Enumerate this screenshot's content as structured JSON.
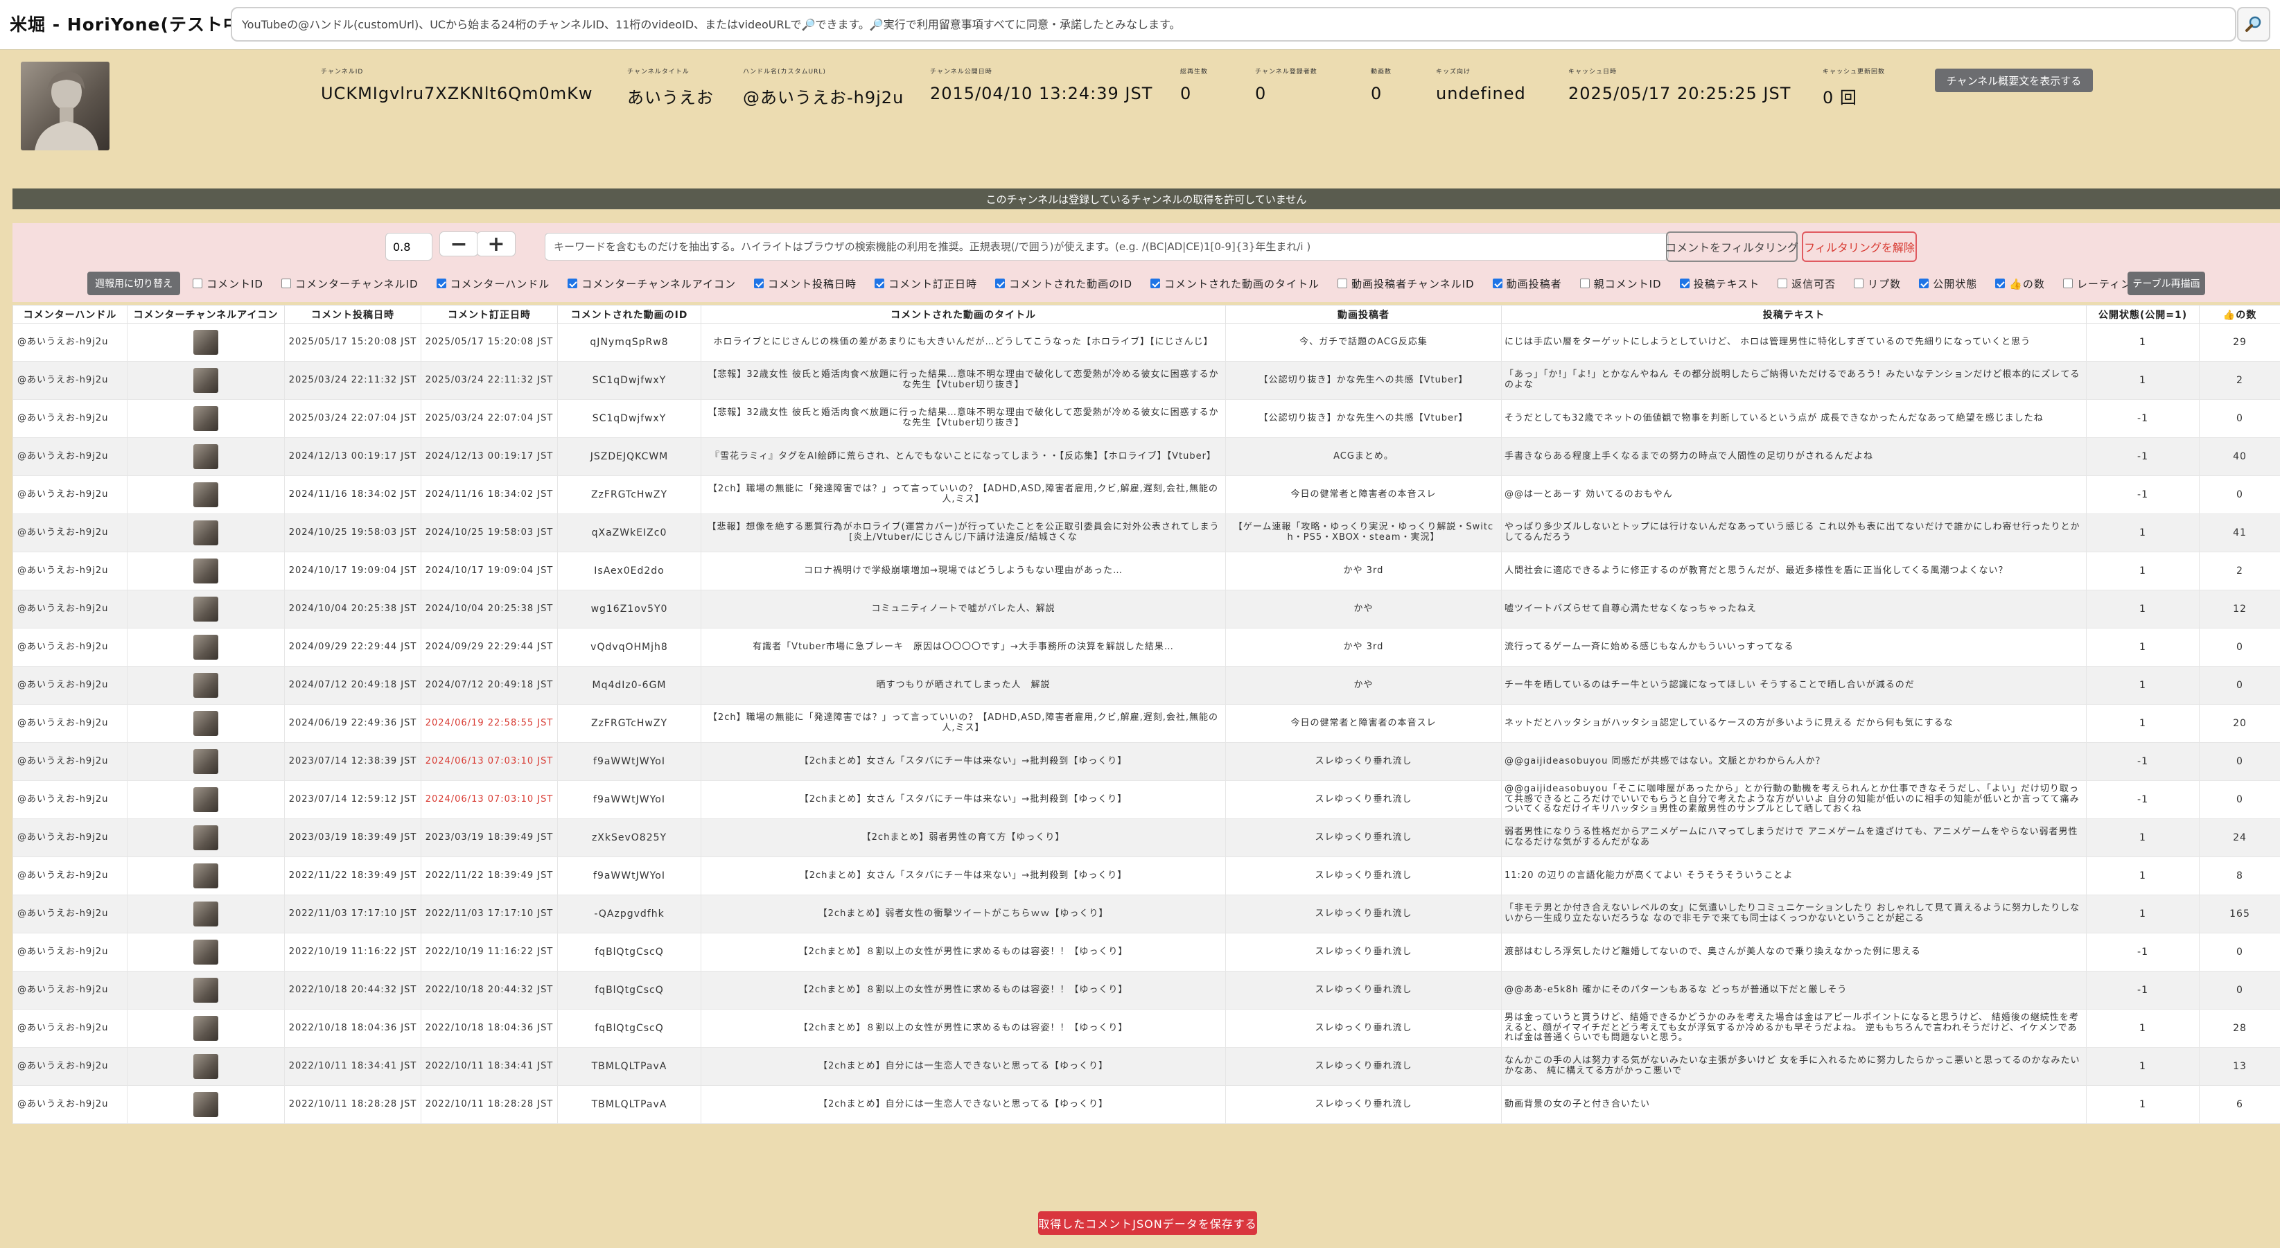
{
  "app": {
    "title": "米堀 - HoriYone(テスト中)"
  },
  "search": {
    "placeholder": "YouTubeの@ハンドル(customUrl)、UCから始まる24桁のチャンネルID、11桁のvideoID、またはvideoURLで🔎できます。🔎実行で利用留意事項すべてに同意・承諾したとみなします。",
    "button_icon": "magnifier-icon"
  },
  "channel": {
    "fields": [
      {
        "label": "チャンネルID",
        "value": "UCKMIgvlru7XZKNlt6Qm0mKw"
      },
      {
        "label": "チャンネルタイトル",
        "value": "あいうえお"
      },
      {
        "label": "ハンドル名(カスタムURL)",
        "value": "@あいうえお-h9j2u"
      },
      {
        "label": "チャンネル公開日時",
        "value": "2015/04/10 13:24:39 JST"
      },
      {
        "label": "総再生数",
        "value": "0"
      },
      {
        "label": "チャンネル登録者数",
        "value": "0"
      },
      {
        "label": "動画数",
        "value": "0"
      },
      {
        "label": "キッズ向け",
        "value": "undefined"
      },
      {
        "label": "キャッシュ日時",
        "value": "2025/05/17 20:25:25 JST"
      },
      {
        "label": "キャッシュ更新回数",
        "value": "0 回"
      }
    ],
    "show_description_label": "チャンネル概要文を表示する"
  },
  "notice": "このチャンネルは登録しているチャンネルの取得を許可していません",
  "filter": {
    "threshold_value": "0.8",
    "minus_label": "−",
    "plus_label": "+",
    "keyword_placeholder": "キーワードを含むものだけを抽出する。ハイライトはブラウザの検索機能の利用を推奨。正規表現(/で囲う)が使えます。(e.g. /(BC|AD|CE)1[0-9]{3}年生まれ/i )",
    "filter_button": "コメントをフィルタリング",
    "clear_button": "フィルタリングを解除",
    "compact_button": "週報用に切り替え",
    "redraw_button": "テーブル再描画",
    "toggles": [
      {
        "label": "コメントID",
        "checked": false
      },
      {
        "label": "コメンターチャンネルID",
        "checked": false
      },
      {
        "label": "コメンターハンドル",
        "checked": true
      },
      {
        "label": "コメンターチャンネルアイコン",
        "checked": true
      },
      {
        "label": "コメント投稿日時",
        "checked": true
      },
      {
        "label": "コメント訂正日時",
        "checked": true
      },
      {
        "label": "コメントされた動画のID",
        "checked": true
      },
      {
        "label": "コメントされた動画のタイトル",
        "checked": true
      },
      {
        "label": "動画投稿者チャンネルID",
        "checked": false
      },
      {
        "label": "動画投稿者",
        "checked": true
      },
      {
        "label": "親コメントID",
        "checked": false
      },
      {
        "label": "投稿テキスト",
        "checked": true
      },
      {
        "label": "返信可否",
        "checked": false
      },
      {
        "label": "リプ数",
        "checked": false
      },
      {
        "label": "公開状態",
        "checked": true
      },
      {
        "label": "👍の数",
        "checked": true
      },
      {
        "label": "レーティング",
        "checked": false
      }
    ]
  },
  "table": {
    "columns": [
      "コメンターハンドル",
      "コメンターチャンネルアイコン",
      "コメント投稿日時",
      "コメント訂正日時",
      "コメントされた動画のID",
      "コメントされた動画のタイトル",
      "動画投稿者",
      "投稿テキスト",
      "公開状態(公開=1)",
      "👍の数"
    ],
    "rows": [
      {
        "handle": "@あいうえお-h9j2u",
        "posted": "2025/05/17 15:20:08 JST",
        "edited": "2025/05/17 15:20:08 JST",
        "edited_red": false,
        "video_id": "qJNymqSpRw8",
        "title": "ホロライブとにじさんじの株価の差があまりにも大きいんだが…どうしてこうなった【ホロライブ】【にじさんじ】",
        "author": "今、ガチで話題のACG反応集",
        "text": "にじは手広い層をターゲットにしようとしていけど、 ホロは管理男性に特化しすぎているので先細りになっていくと思う",
        "public": "1",
        "likes": "29"
      },
      {
        "handle": "@あいうえお-h9j2u",
        "posted": "2025/03/24 22:11:32 JST",
        "edited": "2025/03/24 22:11:32 JST",
        "edited_red": false,
        "video_id": "SC1qDwjfwxY",
        "title": "【悲報】32歳女性 彼氏と婚活肉食べ放題に行った結果…意味不明な理由で破化して恋愛熱が冷める彼女に困惑するかな先生【Vtuber切り抜き】",
        "author": "【公認切り抜き】かな先生への共感【Vtuber】",
        "text": "「あっ」「か!」「よ!」とかなんやねん その都分説明したらご納得いただけるであろう！みたいなテンションだけど根本的にズレてるのよな",
        "public": "1",
        "likes": "2"
      },
      {
        "handle": "@あいうえお-h9j2u",
        "posted": "2025/03/24 22:07:04 JST",
        "edited": "2025/03/24 22:07:04 JST",
        "edited_red": false,
        "video_id": "SC1qDwjfwxY",
        "title": "【悲報】32歳女性 彼氏と婚活肉食べ放題に行った結果…意味不明な理由で破化して恋愛熱が冷める彼女に困惑するかな先生【Vtuber切り抜き】",
        "author": "【公認切り抜き】かな先生への共感【Vtuber】",
        "text": "そうだとしても32歳でネットの価値観で物事を判断しているという点が 成長できなかったんだなあって絶望を感じましたね",
        "public": "-1",
        "likes": "0"
      },
      {
        "handle": "@あいうえお-h9j2u",
        "posted": "2024/12/13 00:19:17 JST",
        "edited": "2024/12/13 00:19:17 JST",
        "edited_red": false,
        "video_id": "JSZDEJQKCWM",
        "title": "『雪花ラミィ』タグをAI絵師に荒らされ、とんでもないことになってしまう・・【反応集】【ホロライブ】【Vtuber】",
        "author": "ACGまとめ。",
        "text": "手書きならある程度上手くなるまでの努力の時点で人間性の足切りがされるんだよね",
        "public": "-1",
        "likes": "40"
      },
      {
        "handle": "@あいうえお-h9j2u",
        "posted": "2024/11/16 18:34:02 JST",
        "edited": "2024/11/16 18:34:02 JST",
        "edited_red": false,
        "video_id": "ZzFRGTcHwZY",
        "title": "【2ch】職場の無能に「発達障害では？」って言っていいの？【ADHD,ASD,障害者雇用,クビ,解雇,遅刻,会社,無能の人,ミス】",
        "author": "今日の健常者と障害者の本音スレ",
        "text": "@@は一とあーす 効いてるのおもやん",
        "public": "-1",
        "likes": "0"
      },
      {
        "handle": "@あいうえお-h9j2u",
        "posted": "2024/10/25 19:58:03 JST",
        "edited": "2024/10/25 19:58:03 JST",
        "edited_red": false,
        "video_id": "qXaZWkEIZc0",
        "title": "【悲報】想像を絶する悪質行為がホロライブ(運営カバー)が行っていたことを公正取引委員会に対外公表されてしまう[炎上/Vtuber/にじさんじ/下請け法違反/結城さくな",
        "author": "【ゲーム速報「攻略・ゆっくり実況・ゆっくり解説・Switch・PS5・XBOX・steam・実況】",
        "text": "やっぱり多少ズルしないとトップには行けないんだなあっていう感じる これ以外も表に出てないだけで誰かにしわ寄せ行ったりとかしてるんだろう",
        "public": "1",
        "likes": "41"
      },
      {
        "handle": "@あいうえお-h9j2u",
        "posted": "2024/10/17 19:09:04 JST",
        "edited": "2024/10/17 19:09:04 JST",
        "edited_red": false,
        "video_id": "IsAex0Ed2do",
        "title": "コロナ禍明けで学級崩壊増加→現場ではどうしようもない理由があった…",
        "author": "かや 3rd",
        "text": "人間社会に適応できるように修正するのが教育だと思うんだが、最近多様性を盾に正当化してくる風潮つよくない？",
        "public": "1",
        "likes": "2"
      },
      {
        "handle": "@あいうえお-h9j2u",
        "posted": "2024/10/04 20:25:38 JST",
        "edited": "2024/10/04 20:25:38 JST",
        "edited_red": false,
        "video_id": "wg16Z1ov5Y0",
        "title": "コミュニティノートで嘘がバレた人、解説",
        "author": "かや",
        "text": "嘘ツイートバズらせて自尊心満たせなくなっちゃったねえ",
        "public": "1",
        "likes": "12"
      },
      {
        "handle": "@あいうえお-h9j2u",
        "posted": "2024/09/29 22:29:44 JST",
        "edited": "2024/09/29 22:29:44 JST",
        "edited_red": false,
        "video_id": "vQdvqOHMjh8",
        "title": "有識者「Vtuber市場に急ブレーキ　原因は〇〇〇〇です」→大手事務所の決算を解説した結果…",
        "author": "かや 3rd",
        "text": "流行ってるゲーム一斉に始める感じもなんかもういいっすってなる",
        "public": "1",
        "likes": "0"
      },
      {
        "handle": "@あいうえお-h9j2u",
        "posted": "2024/07/12 20:49:18 JST",
        "edited": "2024/07/12 20:49:18 JST",
        "edited_red": false,
        "video_id": "Mq4dIz0-6GM",
        "title": "晒すつもりが晒されてしまった人　解説",
        "author": "かや",
        "text": "チー牛を晒しているのはチー牛という認識になってほしい そうすることで晒し合いが減るのだ",
        "public": "1",
        "likes": "0"
      },
      {
        "handle": "@あいうえお-h9j2u",
        "posted": "2024/06/19 22:49:36 JST",
        "edited": "2024/06/19 22:58:55 JST",
        "edited_red": true,
        "video_id": "ZzFRGTcHwZY",
        "title": "【2ch】職場の無能に「発達障害では？」って言っていいの？【ADHD,ASD,障害者雇用,クビ,解雇,遅刻,会社,無能の人,ミス】",
        "author": "今日の健常者と障害者の本音スレ",
        "text": "ネットだとハッタショがハッタショ認定しているケースの方が多いように見える だから何も気にするな",
        "public": "1",
        "likes": "20"
      },
      {
        "handle": "@あいうえお-h9j2u",
        "posted": "2023/07/14 12:38:39 JST",
        "edited": "2024/06/13 07:03:10 JST",
        "edited_red": true,
        "video_id": "f9aWWtJWYoI",
        "title": "【2chまとめ】女さん「スタバにチー牛は来ない」→批判殺到【ゆっくり】",
        "author": "スレゆっくり垂れ流し",
        "text": "@@gaijideasobuyou 同感だが共感ではない。文脈とかわからん人か？",
        "public": "-1",
        "likes": "0"
      },
      {
        "handle": "@あいうえお-h9j2u",
        "posted": "2023/07/14 12:59:12 JST",
        "edited": "2024/06/13 07:03:10 JST",
        "edited_red": true,
        "video_id": "f9aWWtJWYoI",
        "title": "【2chまとめ】女さん「スタバにチー牛は来ない」→批判殺到【ゆっくり】",
        "author": "スレゆっくり垂れ流し",
        "text": "@@gaijideasobuyou「そこに咖啡屋があったから」とか行動の動機を考えられんとか仕事できなそうだし、「よい」だけ切り取って共感できるところだけでいいでもらうと自分で考えたような方がいいよ 自分の知能が低いのに相手の知能が低いとか言ってて痛みついてくるなだけイキリハッタショ男性の素敵男性のサンプルとして晒しておくね",
        "public": "-1",
        "likes": "0"
      },
      {
        "handle": "@あいうえお-h9j2u",
        "posted": "2023/03/19 18:39:49 JST",
        "edited": "2023/03/19 18:39:49 JST",
        "edited_red": false,
        "video_id": "zXkSevO825Y",
        "title": "【2chまとめ】弱者男性の育て方【ゆっくり】",
        "author": "スレゆっくり垂れ流し",
        "text": "弱者男性になりうる性格だからアニメゲームにハマってしまうだけで アニメゲームを遠ざけても、アニメゲームをやらない弱者男性になるだけな気がするんだがなあ",
        "public": "1",
        "likes": "24"
      },
      {
        "handle": "@あいうえお-h9j2u",
        "posted": "2022/11/22 18:39:49 JST",
        "edited": "2022/11/22 18:39:49 JST",
        "edited_red": false,
        "video_id": "f9aWWtJWYoI",
        "title": "【2chまとめ】女さん「スタバにチー牛は来ない」→批判殺到【ゆっくり】",
        "author": "スレゆっくり垂れ流し",
        "text": "11:20 の辺りの言語化能力が高くてよい そうそうそういうことよ",
        "public": "1",
        "likes": "8"
      },
      {
        "handle": "@あいうえお-h9j2u",
        "posted": "2022/11/03 17:17:10 JST",
        "edited": "2022/11/03 17:17:10 JST",
        "edited_red": false,
        "video_id": "-QAzpgvdfhk",
        "title": "【2chまとめ】弱者女性の衝撃ツイートがこちらｗｗ【ゆっくり】",
        "author": "スレゆっくり垂れ流し",
        "text": "「非モテ男とか付き合えないレベルの女」に気遣いしたりコミュニケーションしたり おしゃれして見て貰えるように努力したりしないから一生成り立たないだろうな なので非モテで来ても同士はくっつかないということが起こる",
        "public": "1",
        "likes": "165"
      },
      {
        "handle": "@あいうえお-h9j2u",
        "posted": "2022/10/19 11:16:22 JST",
        "edited": "2022/10/19 11:16:22 JST",
        "edited_red": false,
        "video_id": "fqBlQtgCscQ",
        "title": "【2chまとめ】８割以上の女性が男性に求めるものは容姿！！【ゆっくり】",
        "author": "スレゆっくり垂れ流し",
        "text": "渡部はむしろ浮気したけど離婚してないので、奥さんが美人なので乗り換えなかった例に思える",
        "public": "-1",
        "likes": "0"
      },
      {
        "handle": "@あいうえお-h9j2u",
        "posted": "2022/10/18 20:44:32 JST",
        "edited": "2022/10/18 20:44:32 JST",
        "edited_red": false,
        "video_id": "fqBlQtgCscQ",
        "title": "【2chまとめ】８割以上の女性が男性に求めるものは容姿！！【ゆっくり】",
        "author": "スレゆっくり垂れ流し",
        "text": "@@ああ-e5k8h 確かにそのパターンもあるな どっちが普通以下だと厳しそう",
        "public": "-1",
        "likes": "0"
      },
      {
        "handle": "@あいうえお-h9j2u",
        "posted": "2022/10/18 18:04:36 JST",
        "edited": "2022/10/18 18:04:36 JST",
        "edited_red": false,
        "video_id": "fqBlQtgCscQ",
        "title": "【2chまとめ】８割以上の女性が男性に求めるものは容姿！！【ゆっくり】",
        "author": "スレゆっくり垂れ流し",
        "text": "男は金っていうと貰うけど、結婚できるかどうかのみを考えた場合は金はアピールポイントになると思うけど、 結婚後の継続性を考えると、顔がイマイチだとどう考えても女が浮気するか冷めるかも早そうだよね。 逆ももちろんで言われそうだけど、イケメンであれば金は普通くらいでも問題ないと思う。",
        "public": "1",
        "likes": "28"
      },
      {
        "handle": "@あいうえお-h9j2u",
        "posted": "2022/10/11 18:34:41 JST",
        "edited": "2022/10/11 18:34:41 JST",
        "edited_red": false,
        "video_id": "TBMLQLTPavA",
        "title": "【2chまとめ】自分には一生恋人できないと思ってる【ゆっくり】",
        "author": "スレゆっくり垂れ流し",
        "text": "なんかこの手の人は努力する気がないみたいな主張が多いけど 女を手に入れるために努力したらかっこ悪いと思ってるのかなみたいかなあ、 純に構えてる方がかっこ悪いで",
        "public": "1",
        "likes": "13"
      },
      {
        "handle": "@あいうえお-h9j2u",
        "posted": "2022/10/11 18:28:28 JST",
        "edited": "2022/10/11 18:28:28 JST",
        "edited_red": false,
        "video_id": "TBMLQLTPavA",
        "title": "【2chまとめ】自分には一生恋人できないと思ってる【ゆっくり】",
        "author": "スレゆっくり垂れ流し",
        "text": "動画背景の女の子と付き合いたい",
        "public": "1",
        "likes": "6"
      }
    ]
  },
  "save_button": "取得したコメントJSONデータを保存する"
}
